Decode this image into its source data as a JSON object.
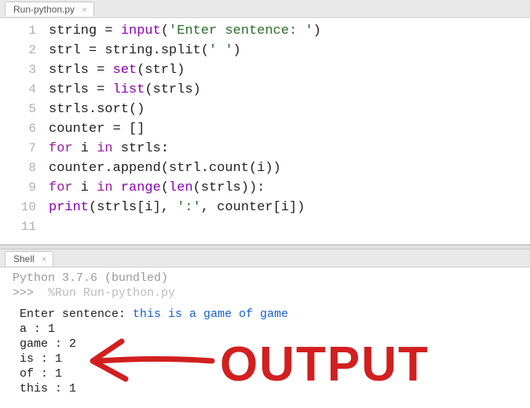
{
  "editor_tab": {
    "filename": "Run-python.py"
  },
  "code": {
    "lines": [
      {
        "n": "1",
        "t": [
          [
            "id",
            "string "
          ],
          [
            "op",
            "= "
          ],
          [
            "fn",
            "input"
          ],
          [
            "op",
            "("
          ],
          [
            "str",
            "'Enter sentence: '"
          ],
          [
            "op",
            ")"
          ]
        ]
      },
      {
        "n": "2",
        "t": [
          [
            "id",
            "strl "
          ],
          [
            "op",
            "= string.split("
          ],
          [
            "str",
            "' '"
          ],
          [
            "op",
            ")"
          ]
        ]
      },
      {
        "n": "3",
        "t": [
          [
            "id",
            "strls "
          ],
          [
            "op",
            "= "
          ],
          [
            "fn",
            "set"
          ],
          [
            "op",
            "(strl)"
          ]
        ]
      },
      {
        "n": "4",
        "t": [
          [
            "id",
            "strls "
          ],
          [
            "op",
            "= "
          ],
          [
            "fn",
            "list"
          ],
          [
            "op",
            "(strls)"
          ]
        ]
      },
      {
        "n": "5",
        "t": [
          [
            "id",
            "strls.sort()"
          ]
        ]
      },
      {
        "n": "6",
        "t": [
          [
            "id",
            "counter "
          ],
          [
            "op",
            "= []"
          ]
        ]
      },
      {
        "n": "7",
        "t": [
          [
            "kw",
            "for"
          ],
          [
            "id",
            " i "
          ],
          [
            "kw",
            "in"
          ],
          [
            "id",
            " strls:"
          ]
        ]
      },
      {
        "n": "8",
        "t": [
          [
            "id",
            "    counter.append(strl.count(i))"
          ]
        ]
      },
      {
        "n": "9",
        "t": [
          [
            "kw",
            "for"
          ],
          [
            "id",
            " i "
          ],
          [
            "kw",
            "in"
          ],
          [
            "id",
            " "
          ],
          [
            "fn",
            "range"
          ],
          [
            "op",
            "("
          ],
          [
            "fn",
            "len"
          ],
          [
            "op",
            "(strls)):"
          ]
        ]
      },
      {
        "n": "10",
        "t": [
          [
            "id",
            "    "
          ],
          [
            "fn",
            "print"
          ],
          [
            "op",
            "(strls[i], "
          ],
          [
            "str",
            "':'"
          ],
          [
            "op",
            ", counter[i])"
          ]
        ]
      },
      {
        "n": "11",
        "t": []
      }
    ]
  },
  "shell_tab": "Shell",
  "shell": {
    "version": "Python 3.7.6 (bundled)",
    "prompt": ">>>",
    "run": "%Run Run-python.py",
    "echo_label": "Enter sentence: ",
    "user_input": "this is a game of game",
    "output_lines": [
      "a : 1",
      "game : 2",
      "is : 1",
      "of : 1",
      "this : 1"
    ]
  },
  "annotation_text": "OUTPUT",
  "annotation_color": "#d21f1f"
}
